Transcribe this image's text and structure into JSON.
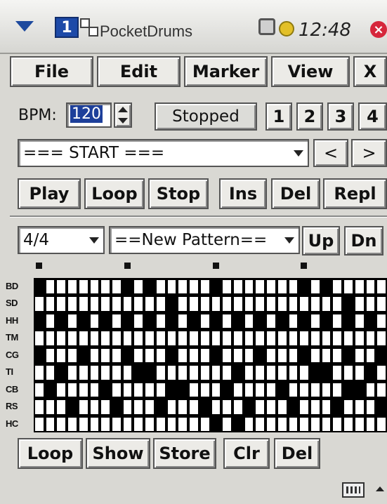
{
  "titlebar": {
    "app_name": "PocketDrums",
    "time": "12:48"
  },
  "menu": [
    {
      "label": "File"
    },
    {
      "label": "Edit"
    },
    {
      "label": "Marker"
    },
    {
      "label": "View"
    },
    {
      "label": "X"
    }
  ],
  "transport": {
    "bpm_label": "BPM:",
    "bpm_value": "120",
    "status": "Stopped",
    "pages": [
      "1",
      "2",
      "3",
      "4"
    ]
  },
  "song": {
    "selected": "=== START ===",
    "prev": "<",
    "next": ">"
  },
  "controls": [
    "Play",
    "Loop",
    "Stop",
    "Ins",
    "Del",
    "Repl"
  ],
  "pattern": {
    "signature": "4/4",
    "name": "==New Pattern==",
    "up": "Up",
    "dn": "Dn"
  },
  "grid": {
    "rows": [
      "BD",
      "SD",
      "HH",
      "TM",
      "CG",
      "TI",
      "CB",
      "RS",
      "HC"
    ],
    "steps": 32,
    "beat_markers": [
      0,
      8,
      16,
      24
    ],
    "pattern": [
      [
        1,
        0,
        0,
        0,
        0,
        0,
        0,
        0,
        1,
        0,
        1,
        0,
        0,
        0,
        0,
        0,
        1,
        0,
        0,
        0,
        0,
        0,
        0,
        0,
        1,
        0,
        1,
        0,
        0,
        0,
        0,
        0
      ],
      [
        0,
        0,
        0,
        0,
        0,
        0,
        0,
        0,
        0,
        0,
        0,
        0,
        1,
        0,
        0,
        0,
        0,
        0,
        0,
        0,
        0,
        0,
        0,
        0,
        0,
        0,
        0,
        0,
        1,
        0,
        0,
        0
      ],
      [
        1,
        0,
        1,
        0,
        1,
        0,
        1,
        0,
        1,
        0,
        1,
        0,
        1,
        0,
        1,
        0,
        1,
        0,
        1,
        0,
        1,
        0,
        1,
        0,
        1,
        0,
        1,
        0,
        1,
        0,
        1,
        0
      ],
      [
        0,
        0,
        0,
        0,
        0,
        0,
        0,
        0,
        0,
        0,
        0,
        0,
        0,
        0,
        0,
        0,
        0,
        0,
        0,
        0,
        0,
        0,
        0,
        0,
        0,
        0,
        0,
        0,
        0,
        0,
        0,
        0
      ],
      [
        1,
        0,
        0,
        0,
        1,
        0,
        0,
        0,
        1,
        0,
        0,
        0,
        1,
        0,
        0,
        0,
        1,
        0,
        0,
        0,
        1,
        0,
        0,
        0,
        1,
        0,
        0,
        0,
        1,
        0,
        0,
        1
      ],
      [
        0,
        0,
        1,
        0,
        0,
        0,
        0,
        0,
        0,
        1,
        1,
        0,
        0,
        0,
        0,
        0,
        0,
        0,
        1,
        0,
        0,
        0,
        0,
        0,
        0,
        1,
        1,
        0,
        0,
        0,
        1,
        0
      ],
      [
        0,
        1,
        0,
        0,
        0,
        0,
        1,
        0,
        0,
        0,
        0,
        0,
        1,
        1,
        0,
        0,
        0,
        1,
        0,
        0,
        0,
        0,
        1,
        0,
        0,
        0,
        0,
        0,
        1,
        1,
        0,
        0
      ],
      [
        0,
        0,
        0,
        1,
        0,
        0,
        0,
        1,
        0,
        0,
        0,
        1,
        0,
        0,
        0,
        1,
        0,
        0,
        0,
        1,
        0,
        0,
        0,
        1,
        0,
        0,
        0,
        1,
        0,
        0,
        0,
        1
      ],
      [
        0,
        0,
        0,
        0,
        0,
        0,
        0,
        0,
        0,
        0,
        0,
        0,
        0,
        0,
        0,
        0,
        1,
        0,
        1,
        0,
        0,
        0,
        0,
        0,
        0,
        0,
        0,
        0,
        0,
        0,
        0,
        0
      ]
    ]
  },
  "bottom": [
    "Loop",
    "Show",
    "Store",
    "Clr",
    "Del"
  ]
}
